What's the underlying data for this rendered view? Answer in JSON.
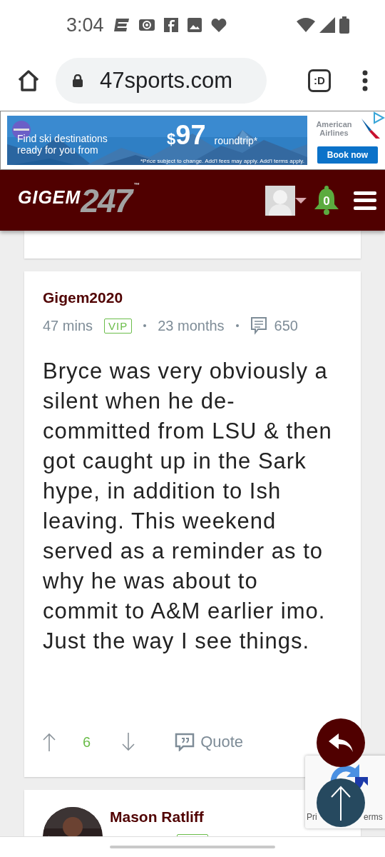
{
  "status_bar": {
    "time": "3:04"
  },
  "browser": {
    "url": "47sports.com",
    "tabs_label": ":D"
  },
  "ad": {
    "headline": "Find ski destinations ready for you from",
    "currency": "$",
    "price": "97",
    "price_note": "roundtrip*",
    "fine_print": "*Price subject to change. Add'l fees may apply. Add'l terms apply.",
    "brand": "American Airlines",
    "button": "Book now"
  },
  "header": {
    "logo_word": "GIGEM",
    "logo_number": "247",
    "logo_mark": "™",
    "notifications": "0"
  },
  "post": {
    "author": "Gigem2020",
    "time": "47 mins",
    "badge": "VIP",
    "tenure": "23 months",
    "post_count": "650",
    "body": "Bryce was very obviously a silent when he de-committed from LSU & then got caught up in the Sark hype, in addition to Ish leaving. This weekend served as a reminder as to why he was about to commit to A&M earlier imo. Just the way I see things.",
    "score": "6",
    "quote": "Quote"
  },
  "next_post": {
    "author": "Mason Ratliff"
  },
  "recaptcha": {
    "left": "Pri",
    "right": "erms"
  }
}
